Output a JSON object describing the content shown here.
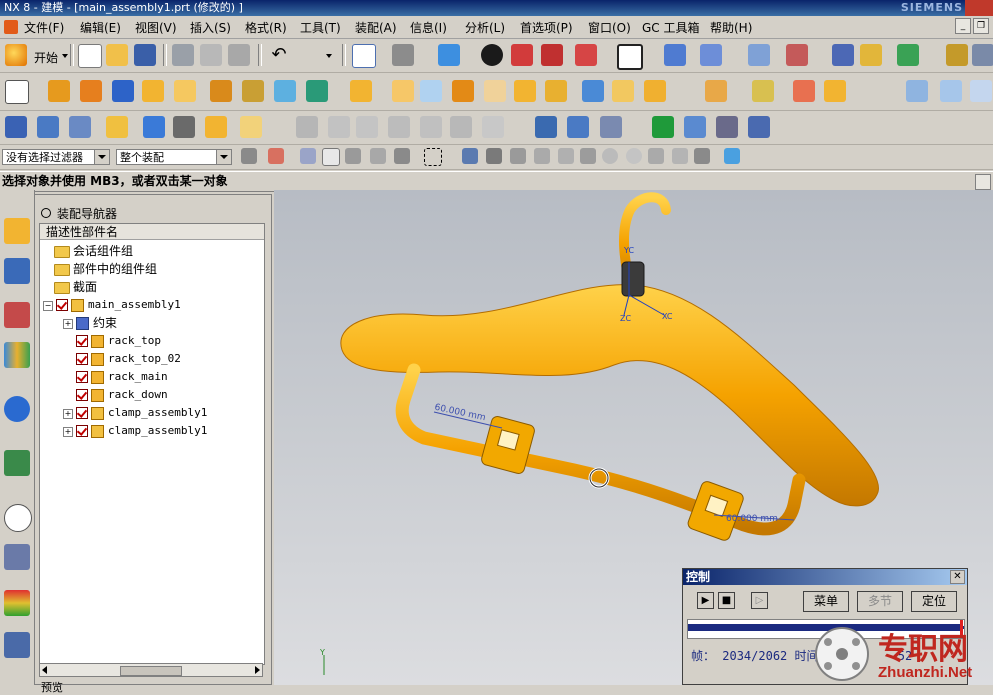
{
  "window": {
    "title": "NX 8 - 建模 - [main_assembly1.prt (修改的) ]",
    "brand": "SIEMENS"
  },
  "menu": [
    "文件(F)",
    "编辑(E)",
    "视图(V)",
    "插入(S)",
    "格式(R)",
    "工具(T)",
    "装配(A)",
    "信息(I)",
    "分析(L)",
    "首选项(P)",
    "窗口(O)",
    "GC 工具箱",
    "帮助(H)"
  ],
  "toolbar": {
    "start_label": "开始",
    "filter_select": "没有选择过滤器",
    "scope_select": "整个装配"
  },
  "status": {
    "cue": "选择对象并使用 MB3，或者双击某一对象"
  },
  "navigator": {
    "title": "装配导航器",
    "column_header": "描述性部件名",
    "nodes": [
      {
        "label": "会话组件组"
      },
      {
        "label": "部件中的组件组"
      },
      {
        "label": "截面"
      },
      {
        "label": "main_assembly1"
      },
      {
        "label": "约束"
      },
      {
        "label": "rack_top"
      },
      {
        "label": "rack_top_02"
      },
      {
        "label": "rack_main"
      },
      {
        "label": "rack_down"
      },
      {
        "label": "clamp_assembly1"
      },
      {
        "label": "clamp_assembly1"
      }
    ],
    "bottom_tab": "预览"
  },
  "viewport": {
    "axis_yc": "YC",
    "axis_xc": "XC",
    "axis_zc": "ZC",
    "dim_1": "60.000 mm",
    "dim_2": "60.000 mm",
    "triad_y": "Y"
  },
  "control_dialog": {
    "title": "控制",
    "menu_button": "菜单",
    "step_button": "多节",
    "locate_button": "定位",
    "frame_label": "帧：",
    "frame_value": "2034/2062",
    "time_label": "时间",
    "time_value": "52",
    "progress": 0.986
  },
  "watermark": {
    "title": "专职网",
    "url": "Zhuanzhi.Net"
  },
  "colors": {
    "part": "#f5a200",
    "part_dark": "#c47800",
    "title_bar": "#0a246a",
    "watermark": "#c0271f"
  }
}
